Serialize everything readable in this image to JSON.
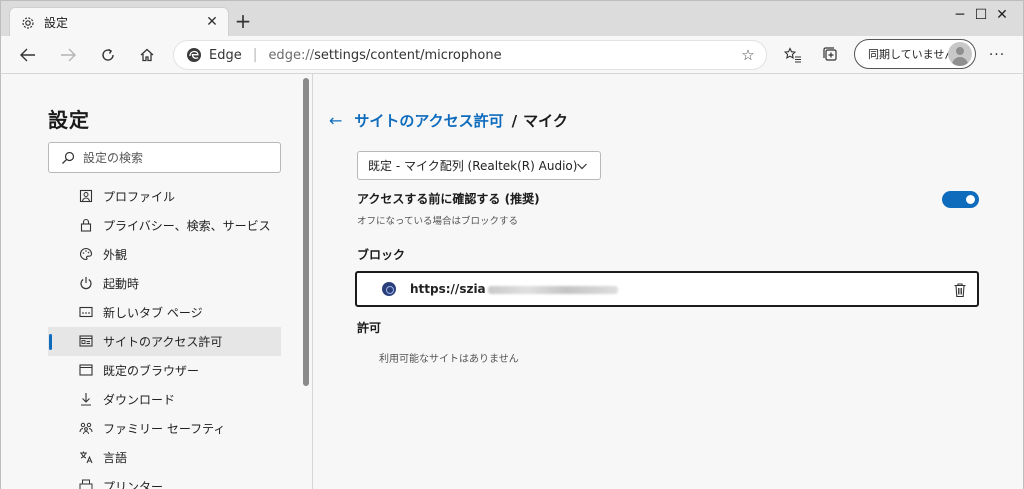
{
  "tab": {
    "title": "設定",
    "close": "✕"
  },
  "newtab": "+",
  "window": {
    "minimize": "─",
    "maximize": "☐",
    "close": "✕"
  },
  "addressbar": {
    "brand": "Edge",
    "separator": "|",
    "url_scheme": "edge://",
    "url_path": "settings/content/microphone"
  },
  "sync": {
    "label": "同期していません"
  },
  "sidebar": {
    "title": "設定",
    "search_placeholder": "設定の検索",
    "items": [
      {
        "label": "プロファイル",
        "icon": "profile-icon",
        "active": false
      },
      {
        "label": "プライバシー、検索、サービス",
        "icon": "lock-icon",
        "active": false
      },
      {
        "label": "外観",
        "icon": "palette-icon",
        "active": false
      },
      {
        "label": "起動時",
        "icon": "power-icon",
        "active": false
      },
      {
        "label": "新しいタブ ページ",
        "icon": "newtab-icon",
        "active": false
      },
      {
        "label": "サイトのアクセス許可",
        "icon": "site-permissions-icon",
        "active": true
      },
      {
        "label": "既定のブラウザー",
        "icon": "browser-icon",
        "active": false
      },
      {
        "label": "ダウンロード",
        "icon": "download-icon",
        "active": false
      },
      {
        "label": "ファミリー セーフティ",
        "icon": "family-icon",
        "active": false
      },
      {
        "label": "言語",
        "icon": "language-icon",
        "active": false
      },
      {
        "label": "プリンター",
        "icon": "printer-icon",
        "active": false
      }
    ]
  },
  "main": {
    "breadcrumb_parent": "サイトのアクセス許可",
    "breadcrumb_separator": "/",
    "breadcrumb_current": "マイク",
    "device_select": "既定 - マイク配列 (Realtek(R) Audio)",
    "ask_title": "アクセスする前に確認する (推奨)",
    "ask_subtitle": "オフになっている場合はブロックする",
    "ask_enabled": true,
    "block_heading": "ブロック",
    "blocked_sites": [
      {
        "url": "https://szia"
      }
    ],
    "allow_heading": "許可",
    "allow_empty": "利用可能なサイトはありません"
  },
  "colors": {
    "accent": "#0f6cbd",
    "toolbar": "#f7f7f7",
    "titlebar": "#dcdcdc"
  }
}
